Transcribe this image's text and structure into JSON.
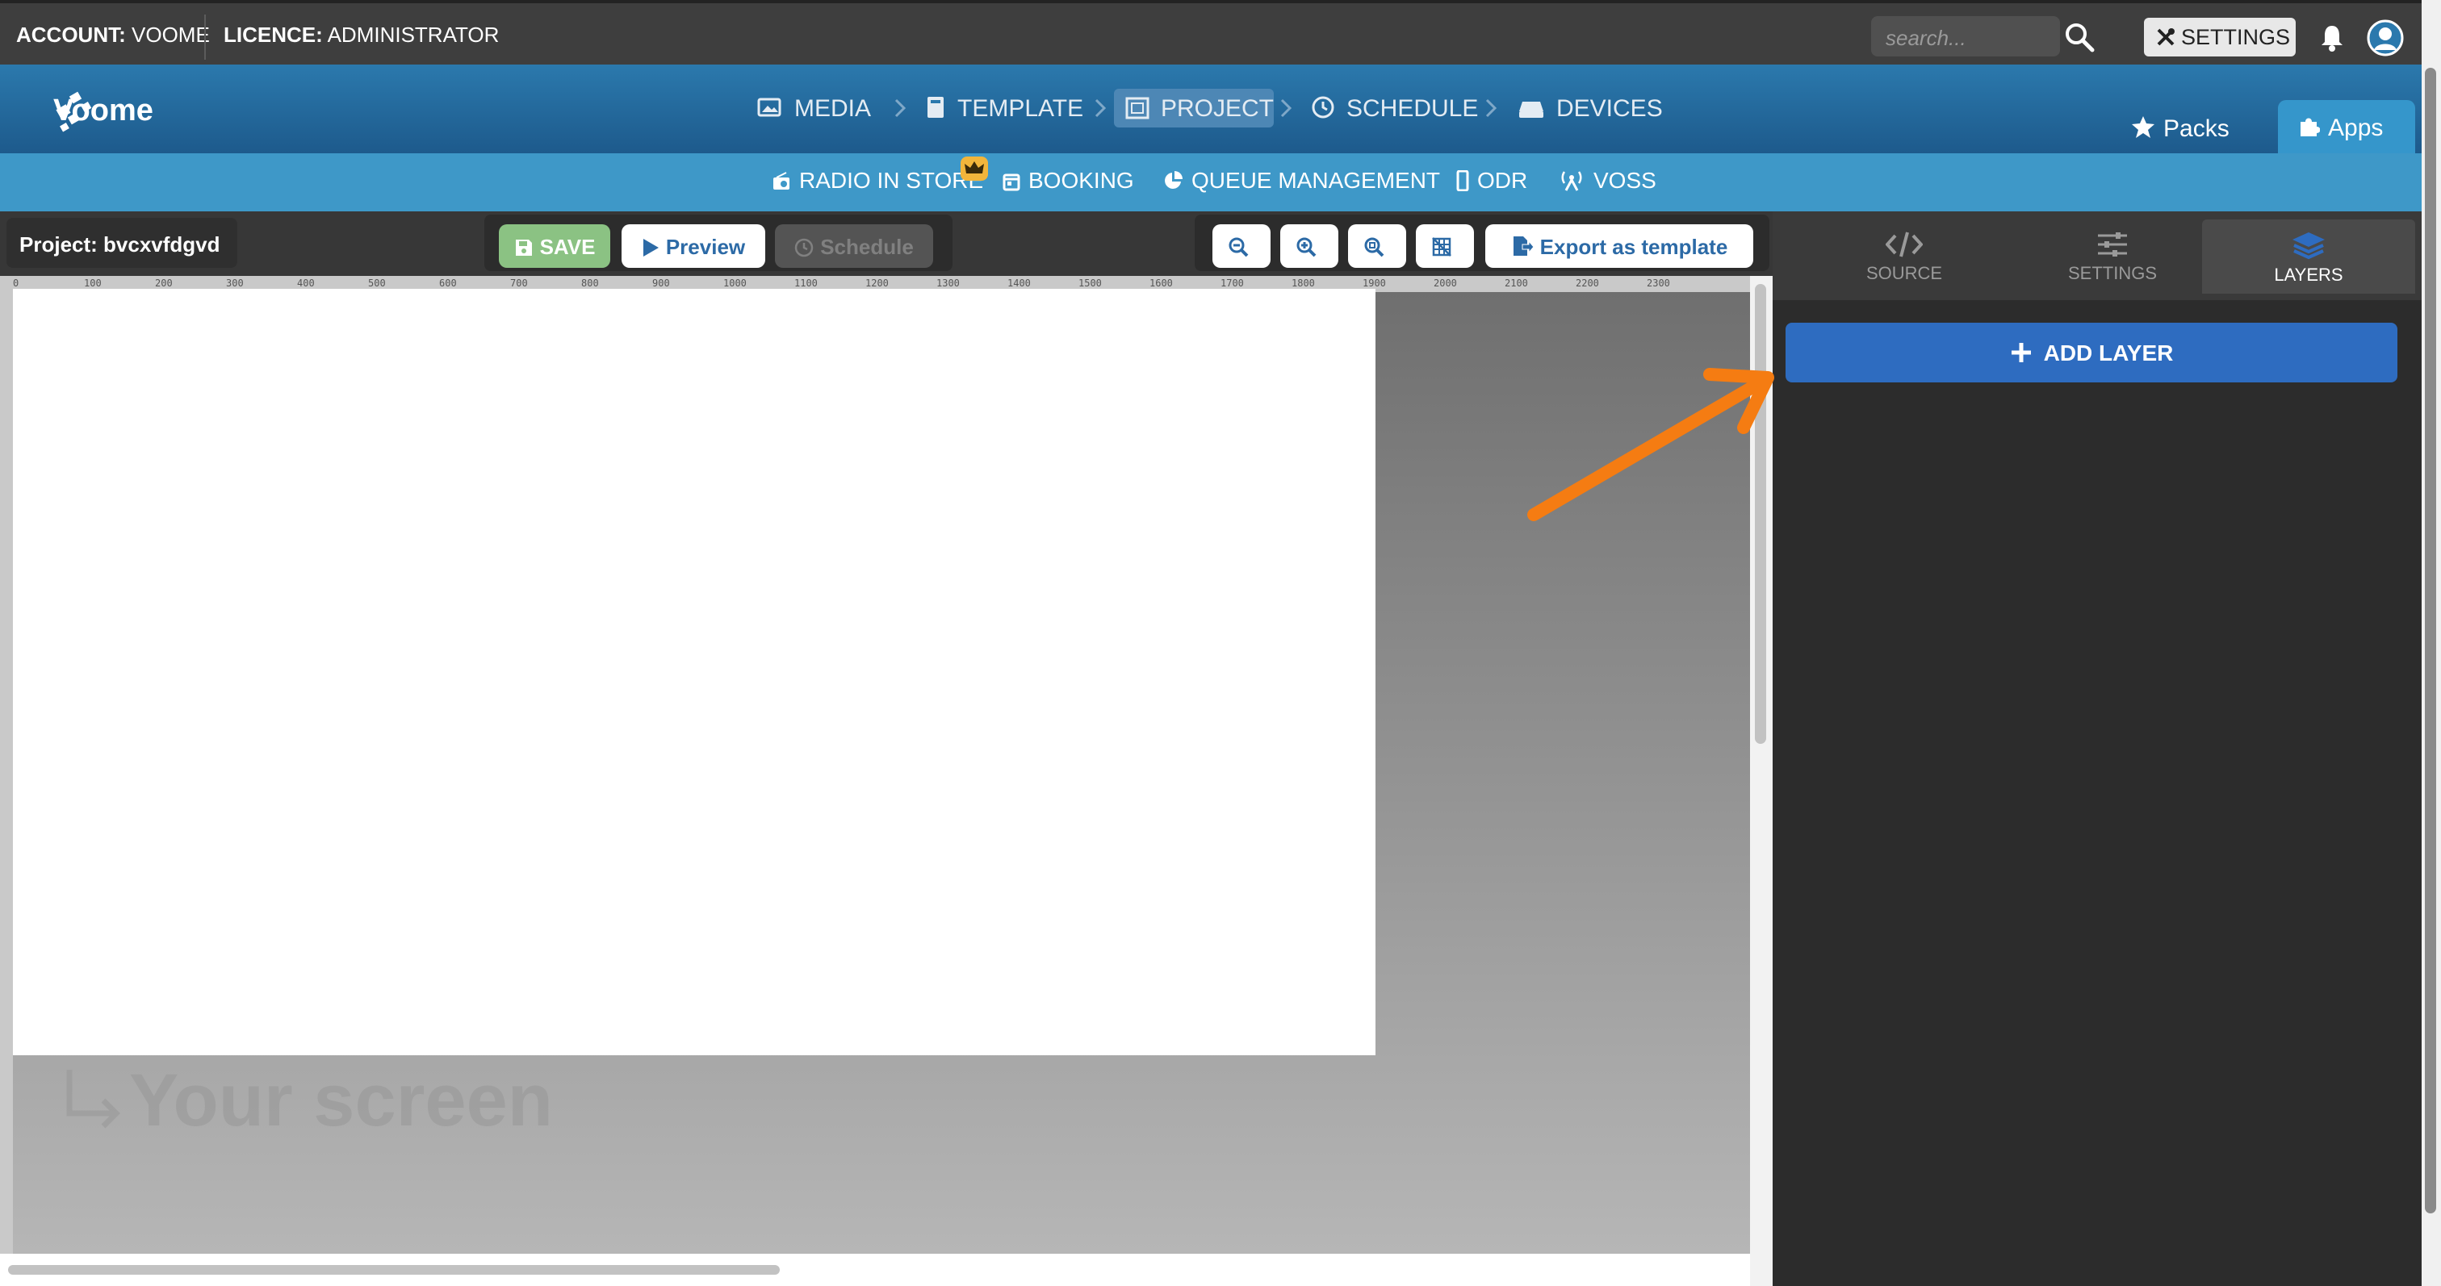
{
  "topbar": {
    "account_label": "ACCOUNT:",
    "account_value": "VOOME",
    "licence_label": "LICENCE:",
    "licence_value": "ADMINISTRATOR",
    "search_placeholder": "search...",
    "settings_label": "SETTINGS"
  },
  "brand": {
    "name": "Voome"
  },
  "nav": {
    "crumbs": [
      {
        "label": "MEDIA",
        "icon": "image-icon"
      },
      {
        "label": "TEMPLATE",
        "icon": "book-icon"
      },
      {
        "label": "PROJECT",
        "icon": "frame-icon",
        "active": true
      },
      {
        "label": "SCHEDULE",
        "icon": "clock-icon"
      },
      {
        "label": "DEVICES",
        "icon": "drive-icon"
      }
    ],
    "packs_label": "Packs",
    "apps_label": "Apps"
  },
  "subnav": {
    "items": [
      "RADIO IN STORE",
      "BOOKING",
      "QUEUE MANAGEMENT",
      "ODR",
      "VOSS"
    ]
  },
  "editor": {
    "project_title": "Project: bvcxvfdgvd",
    "save_label": "SAVE",
    "preview_label": "Preview",
    "schedule_label": "Schedule",
    "export_label": "Export as template",
    "your_screen_label": "Your screen",
    "ruler_ticks": [
      "0",
      "100",
      "200",
      "300",
      "400",
      "500",
      "600",
      "700",
      "800",
      "900",
      "1000",
      "1100",
      "1200",
      "1300",
      "1400",
      "1500",
      "1600",
      "1700",
      "1800",
      "1900",
      "2000",
      "2100",
      "2200",
      "2300"
    ]
  },
  "panel": {
    "tabs": [
      {
        "label": "SOURCE",
        "icon": "code-icon"
      },
      {
        "label": "SETTINGS",
        "icon": "sliders-icon"
      },
      {
        "label": "LAYERS",
        "icon": "layers-icon",
        "active": true
      }
    ],
    "add_layer_label": "ADD LAYER"
  },
  "colors": {
    "nav_blue": "#2b79ad",
    "subnav_blue": "#3e98c8",
    "save_green": "#8bc283",
    "add_layer_blue": "#2e6cc0",
    "annotation_orange": "#f57c12"
  }
}
